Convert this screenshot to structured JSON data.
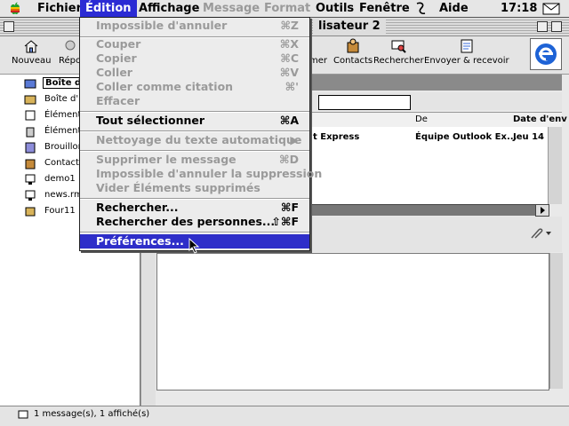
{
  "menubar": {
    "items": [
      "Fichier",
      "Édition",
      "Affichage",
      "Message",
      "Format",
      "Outils",
      "Fenêtre",
      "Aide"
    ],
    "clock": "17:18"
  },
  "window": {
    "title": "lisateur 2"
  },
  "toolbar": {
    "new_label": "Nouveau",
    "reply_label": "Répo",
    "send_partial": "mer",
    "contacts_label": "Contacts",
    "search_label": "Rechercher",
    "send_receive_label": "Envoyer & recevoir"
  },
  "folders": [
    "Boîte d",
    "Boîte d'",
    "Éléments",
    "Éléments",
    "Brouillon",
    "Contacts",
    "demo1",
    "news.rm",
    "Four11"
  ],
  "columns": {
    "from": "De",
    "date": "Date d'env"
  },
  "messages": [
    {
      "subject": "t Express",
      "from": "Équipe Outlook Ex...",
      "date": "Jeu 14"
    }
  ],
  "status": {
    "text": "1 message(s), 1 affiché(s)"
  },
  "edit_menu": {
    "items": [
      {
        "label": "Impossible d'annuler",
        "shortcut": "⌘Z",
        "disabled": true
      },
      {
        "label": "Couper",
        "shortcut": "⌘X",
        "disabled": true
      },
      {
        "label": "Copier",
        "shortcut": "⌘C",
        "disabled": true
      },
      {
        "label": "Coller",
        "shortcut": "⌘V",
        "disabled": true
      },
      {
        "label": "Coller comme citation",
        "shortcut": "⌘'",
        "disabled": true
      },
      {
        "label": "Effacer",
        "shortcut": "",
        "disabled": true
      },
      {
        "label": "Tout sélectionner",
        "shortcut": "⌘A",
        "disabled": false
      },
      {
        "label": "Nettoyage du texte automatique",
        "shortcut": "▶",
        "disabled": true
      },
      {
        "label": "Supprimer le message",
        "shortcut": "⌘D",
        "disabled": true
      },
      {
        "label": "Impossible d'annuler la suppression",
        "shortcut": "",
        "disabled": true
      },
      {
        "label": "Vider Éléments supprimés",
        "shortcut": "",
        "disabled": true
      },
      {
        "label": "Rechercher...",
        "shortcut": "⌘F",
        "disabled": false
      },
      {
        "label": "Rechercher des personnes...",
        "shortcut": "⇧⌘F",
        "disabled": false
      },
      {
        "label": "Préférences...",
        "shortcut": "",
        "disabled": false,
        "highlighted": true
      }
    ]
  },
  "colors": {
    "highlight": "#2e2ec9",
    "disabled": "#9a9a9a"
  }
}
